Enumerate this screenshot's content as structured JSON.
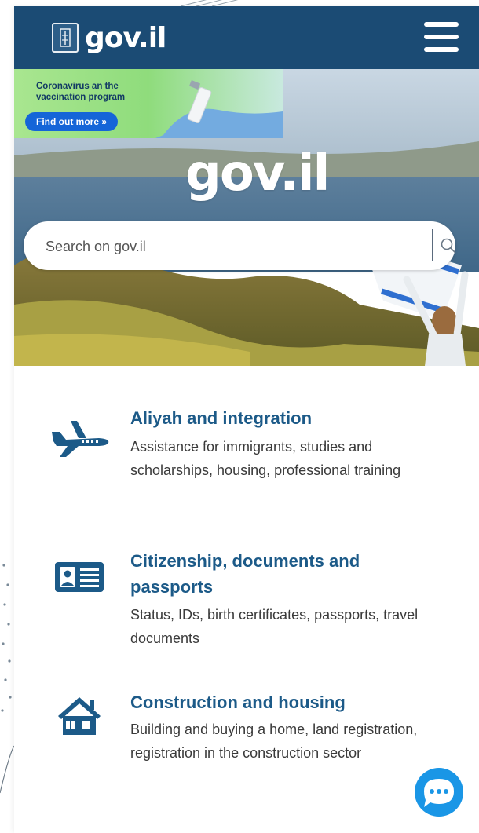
{
  "header": {
    "logo_text": "gov.il",
    "menu_icon": "hamburger-menu-icon",
    "colors": {
      "bar": "#1b4b74",
      "text": "#ffffff"
    }
  },
  "banner": {
    "text": "Coronavirus an the vaccination program",
    "button_label": "Find out more »"
  },
  "hero": {
    "logo_text": "gov.il"
  },
  "search": {
    "placeholder": "Search on gov.il",
    "icon": "search-icon"
  },
  "categories": [
    {
      "icon": "airplane-icon",
      "title": "Aliyah and integration",
      "description": "Assistance for immigrants, studies and scholarships, housing, professional training"
    },
    {
      "icon": "id-card-icon",
      "title": "Citizenship, documents and passports",
      "description": "Status, IDs, birth certificates, passports, travel documents"
    },
    {
      "icon": "house-icon",
      "title": "Construction and housing",
      "description": "Building and buying a home, land registration, registration in the construction sector"
    }
  ],
  "chat": {
    "icon": "chat-bubble-icon"
  },
  "accent_colors": {
    "title": "#1c5a88",
    "chat": "#1a96e6",
    "banner_button": "#1565d8"
  }
}
